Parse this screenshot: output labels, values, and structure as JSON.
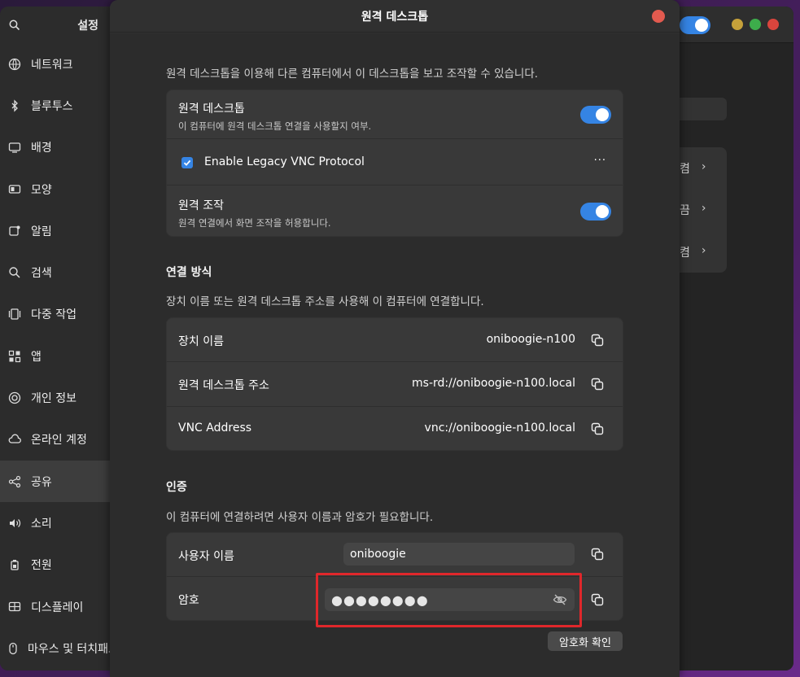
{
  "colors": {
    "accent": "#3584e4",
    "close": "#e25a4f",
    "highlight": "#e0272b",
    "win_minimize": "#c6a13a",
    "win_maximize": "#3dad4b",
    "win_close": "#d9453d"
  },
  "settings": {
    "title": "설정",
    "search_icon": "search-icon",
    "sidebar": [
      {
        "label": "네트워크",
        "icon": "network-icon"
      },
      {
        "label": "블루투스",
        "icon": "bluetooth-icon"
      },
      {
        "label": "배경",
        "icon": "background-icon"
      },
      {
        "label": "모양",
        "icon": "appearance-icon"
      },
      {
        "label": "알림",
        "icon": "notifications-icon"
      },
      {
        "label": "검색",
        "icon": "search-icon"
      },
      {
        "label": "다중 작업",
        "icon": "multitasking-icon"
      },
      {
        "label": "앱",
        "icon": "apps-icon"
      },
      {
        "label": "개인 정보",
        "icon": "privacy-icon"
      },
      {
        "label": "온라인 계정",
        "icon": "cloud-icon"
      },
      {
        "label": "공유",
        "icon": "share-icon"
      },
      {
        "label": "소리",
        "icon": "sound-icon"
      },
      {
        "label": "전원",
        "icon": "power-icon"
      },
      {
        "label": "디스플레이",
        "icon": "display-icon"
      },
      {
        "label": "마우스 및 터치패드",
        "icon": "mouse-icon"
      }
    ],
    "active_item": "공유",
    "background_rows": [
      "켬",
      "끔",
      "켬"
    ]
  },
  "dialog": {
    "title": "원격 데스크톱",
    "intro": "원격 데스크톱을 이용해 다른 컴퓨터에서 이 데스크톱을 보고 조작할 수 있습니다.",
    "remote_desktop": {
      "title": "원격 데스크톱",
      "subtitle": "이 컴퓨터에 원격 데스크톱 연결을 사용할지 여부.",
      "enabled": true
    },
    "legacy_vnc": {
      "label": "Enable Legacy VNC Protocol",
      "checked": true,
      "menu": "···"
    },
    "remote_control": {
      "title": "원격 조작",
      "subtitle": "원격 연결에서 화면 조작을 허용합니다.",
      "enabled": true
    },
    "connection": {
      "heading": "연결 방식",
      "description": "장치 이름 또는 원격 데스크톱 주소를 사용해 이 컴퓨터에 연결합니다.",
      "rows": [
        {
          "label": "장치 이름",
          "value": "oniboogie-n100"
        },
        {
          "label": "원격 데스크톱 주소",
          "value": "ms-rd://oniboogie-n100.local"
        },
        {
          "label": "VNC Address",
          "value": "vnc://oniboogie-n100.local"
        }
      ]
    },
    "auth": {
      "heading": "인증",
      "description": "이 컴퓨터에 연결하려면 사용자 이름과 암호가 필요합니다.",
      "username_label": "사용자 이름",
      "username_value": "oniboogie",
      "password_label": "암호",
      "password_mask": "●●●●●●●●"
    },
    "encrypt_button": "암호화 확인"
  }
}
